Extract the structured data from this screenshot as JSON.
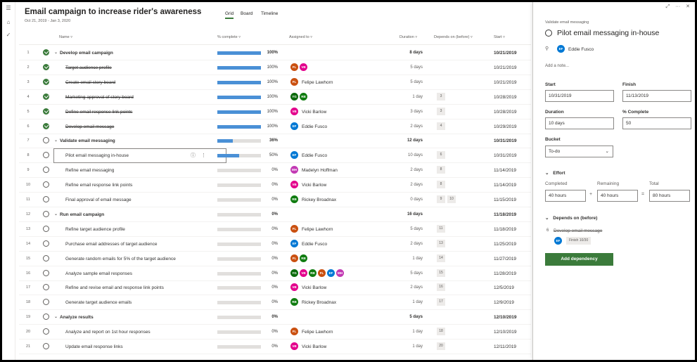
{
  "header": {
    "title": "Email campaign to increase rider's awareness",
    "date_range": "Oct 21, 2019 - Jan 3, 2020",
    "tabs": [
      "Grid",
      "Board",
      "Timeline"
    ]
  },
  "columns": {
    "name": "Name",
    "percent": "% complete",
    "assigned": "Assigned to",
    "duration": "Duration",
    "depends": "Depends on (before)",
    "start": "Start"
  },
  "colors": {
    "accent": "#3b7b3b",
    "progress": "#4a90d6",
    "avatar_fl": "#ca5010",
    "avatar_vb": "#e3008c",
    "avatar_ef": "#0078d4",
    "avatar_rb": "#107c10",
    "avatar_mh": "#c239b3",
    "avatar_yg": "#0b6a0b"
  },
  "rows": [
    {
      "num": "1",
      "name": "Develop email campaign",
      "summary": true,
      "done": true,
      "pct": 1.0,
      "pct_label": "100%",
      "assignees": [],
      "duration": "8 days",
      "deps": [],
      "start": "10/21/2019"
    },
    {
      "num": "2",
      "name": "Target audience profile",
      "summary": false,
      "done": true,
      "pct": 1.0,
      "pct_label": "100%",
      "assignees": [
        {
          "initials": "FL",
          "color": "#ca5010"
        },
        {
          "initials": "VB",
          "color": "#e3008c"
        }
      ],
      "assignee_name": "",
      "duration": "5 days",
      "deps": [],
      "start": "10/21/2019"
    },
    {
      "num": "3",
      "name": "Create email story board",
      "summary": false,
      "done": true,
      "pct": 1.0,
      "pct_label": "100%",
      "assignees": [
        {
          "initials": "FL",
          "color": "#ca5010"
        }
      ],
      "assignee_name": "Felipe Lawhorn",
      "duration": "5 days",
      "deps": [],
      "start": "10/21/2019"
    },
    {
      "num": "4",
      "name": "Marketing approval of story board",
      "summary": false,
      "done": true,
      "pct": 1.0,
      "pct_label": "100%",
      "assignees": [
        {
          "initials": "YG",
          "color": "#0b6a0b"
        },
        {
          "initials": "RB",
          "color": "#107c10"
        }
      ],
      "assignee_name": "",
      "duration": "1 day",
      "deps": [
        "3"
      ],
      "start": "10/28/2019"
    },
    {
      "num": "5",
      "name": "Define email response link points",
      "summary": false,
      "done": true,
      "pct": 1.0,
      "pct_label": "100%",
      "assignees": [
        {
          "initials": "VB",
          "color": "#e3008c"
        }
      ],
      "assignee_name": "Vicki Barlow",
      "duration": "3 days",
      "deps": [
        "3"
      ],
      "start": "10/28/2019"
    },
    {
      "num": "6",
      "name": "Develop email message",
      "summary": false,
      "done": true,
      "pct": 1.0,
      "pct_label": "100%",
      "assignees": [
        {
          "initials": "EF",
          "color": "#0078d4"
        }
      ],
      "assignee_name": "Eddie Fusco",
      "duration": "2 days",
      "deps": [
        "4"
      ],
      "start": "10/29/2019"
    },
    {
      "num": "7",
      "name": "Validate email messaging",
      "summary": true,
      "done": false,
      "pct": 0.36,
      "pct_label": "36%",
      "assignees": [],
      "duration": "12 days",
      "deps": [],
      "start": "10/31/2019"
    },
    {
      "num": "8",
      "name": "Pilot email messaging in-house",
      "summary": false,
      "done": false,
      "selected": true,
      "pct": 0.5,
      "pct_label": "50%",
      "assignees": [
        {
          "initials": "EF",
          "color": "#0078d4"
        }
      ],
      "assignee_name": "Eddie Fusco",
      "duration": "10 days",
      "deps": [
        "6"
      ],
      "start": "10/31/2019"
    },
    {
      "num": "9",
      "name": "Refine email messaging",
      "summary": false,
      "done": false,
      "pct": 0,
      "pct_label": "0%",
      "assignees": [
        {
          "initials": "MH",
          "color": "#c239b3"
        }
      ],
      "assignee_name": "Madelyn Hoffman",
      "duration": "2 days",
      "deps": [
        "8"
      ],
      "start": "11/14/2019"
    },
    {
      "num": "10",
      "name": "Refine email response link points",
      "summary": false,
      "done": false,
      "pct": 0,
      "pct_label": "0%",
      "assignees": [
        {
          "initials": "VB",
          "color": "#e3008c"
        }
      ],
      "assignee_name": "Vicki Barlow",
      "duration": "2 days",
      "deps": [
        "8"
      ],
      "start": "11/14/2019"
    },
    {
      "num": "11",
      "name": "Final approval of email message",
      "summary": false,
      "done": false,
      "pct": 0,
      "pct_label": "0%",
      "assignees": [
        {
          "initials": "RB",
          "color": "#107c10"
        }
      ],
      "assignee_name": "Rickey Broadnax",
      "duration": "0 days",
      "deps": [
        "9",
        "10"
      ],
      "start": "11/15/2019"
    },
    {
      "num": "12",
      "name": "Run email campaign",
      "summary": true,
      "done": false,
      "pct": 0,
      "pct_label": "0%",
      "assignees": [],
      "duration": "16 days",
      "deps": [],
      "start": "11/18/2019"
    },
    {
      "num": "13",
      "name": "Refine target audience profile",
      "summary": false,
      "done": false,
      "pct": 0,
      "pct_label": "0%",
      "assignees": [
        {
          "initials": "FL",
          "color": "#ca5010"
        }
      ],
      "assignee_name": "Felipe Lawhorn",
      "duration": "5 days",
      "deps": [
        "11"
      ],
      "start": "11/18/2019"
    },
    {
      "num": "14",
      "name": "Purchase email addresses of target audience",
      "summary": false,
      "done": false,
      "pct": 0,
      "pct_label": "0%",
      "assignees": [
        {
          "initials": "EF",
          "color": "#0078d4"
        }
      ],
      "assignee_name": "Eddie Fusco",
      "duration": "2 days",
      "deps": [
        "13"
      ],
      "start": "11/25/2019"
    },
    {
      "num": "15",
      "name": "Generate random emails for 5% of the target audience",
      "summary": false,
      "done": false,
      "pct": 0,
      "pct_label": "0%",
      "assignees": [
        {
          "initials": "FL",
          "color": "#ca5010"
        },
        {
          "initials": "RB",
          "color": "#107c10"
        }
      ],
      "assignee_name": "",
      "duration": "1 day",
      "deps": [
        "14"
      ],
      "start": "11/27/2019"
    },
    {
      "num": "16",
      "name": "Analyze sample email responses",
      "summary": false,
      "done": false,
      "pct": 0,
      "pct_label": "0%",
      "assignees": [
        {
          "initials": "YG",
          "color": "#0b6a0b"
        },
        {
          "initials": "VB",
          "color": "#e3008c"
        },
        {
          "initials": "RB",
          "color": "#107c10"
        },
        {
          "initials": "FL",
          "color": "#ca5010"
        },
        {
          "initials": "EF",
          "color": "#0078d4"
        },
        {
          "initials": "MH",
          "color": "#c239b3"
        }
      ],
      "assignee_name": "",
      "duration": "5 days",
      "deps": [
        "15"
      ],
      "start": "11/28/2019"
    },
    {
      "num": "17",
      "name": "Refine and revise email and response link points",
      "summary": false,
      "done": false,
      "pct": 0,
      "pct_label": "0%",
      "assignees": [
        {
          "initials": "VB",
          "color": "#e3008c"
        }
      ],
      "assignee_name": "Vicki Barlow",
      "duration": "2 days",
      "deps": [
        "16"
      ],
      "start": "12/5/2019"
    },
    {
      "num": "18",
      "name": "Generate target audience emails",
      "summary": false,
      "done": false,
      "pct": 0,
      "pct_label": "0%",
      "assignees": [
        {
          "initials": "RB",
          "color": "#107c10"
        }
      ],
      "assignee_name": "Rickey Broadnax",
      "duration": "1 day",
      "deps": [
        "17"
      ],
      "start": "12/9/2019"
    },
    {
      "num": "19",
      "name": "Analyze results",
      "summary": true,
      "done": false,
      "pct": 0,
      "pct_label": "0%",
      "assignees": [],
      "duration": "5 days",
      "deps": [],
      "start": "12/10/2019"
    },
    {
      "num": "20",
      "name": "Analyze and report on 1st hour responses",
      "summary": false,
      "done": false,
      "pct": 0,
      "pct_label": "0%",
      "assignees": [
        {
          "initials": "FL",
          "color": "#ca5010"
        }
      ],
      "assignee_name": "Felipe Lawhorn",
      "duration": "1 day",
      "deps": [
        "18"
      ],
      "start": "12/10/2019"
    },
    {
      "num": "21",
      "name": "Update email response links",
      "summary": false,
      "done": false,
      "pct": 0,
      "pct_label": "0%",
      "assignees": [
        {
          "initials": "VB",
          "color": "#e3008c"
        }
      ],
      "assignee_name": "Vicki Barlow",
      "duration": "1 day",
      "deps": [
        "20"
      ],
      "start": "12/11/2019"
    }
  ],
  "pane": {
    "bucket_label": "Validate email messaging",
    "task_title": "Pilot email messaging in-house",
    "assignee_initials": "EF",
    "assignee_name": "Eddie Fusco",
    "note_placeholder": "Add a note...",
    "start_label": "Start",
    "start_value": "10/31/2019",
    "finish_label": "Finish",
    "finish_value": "11/13/2019",
    "duration_label": "Duration",
    "duration_value": "10 days",
    "pct_label": "% Complete",
    "pct_value": "50",
    "bucket_field_label": "Bucket",
    "bucket_value": "To-do",
    "effort_label": "Effort",
    "completed_label": "Completed",
    "completed_value": "40 hours",
    "remaining_label": "Remaining",
    "remaining_value": "40 hours",
    "total_label": "Total",
    "total_value": "80 hours",
    "plus": "+",
    "equals": "=",
    "depends_label": "Depends on (before)",
    "dep_num": "6",
    "dep_name": "Develop email message",
    "dep_avatar": "EF",
    "dep_finish": "Finish 10/30",
    "add_dependency": "Add dependency"
  },
  "icons": [
    "hamburger-icon",
    "home-icon",
    "check-icon",
    "chevron-down-icon",
    "info-icon",
    "more-icon",
    "person-icon",
    "expand-icon",
    "close-icon"
  ]
}
